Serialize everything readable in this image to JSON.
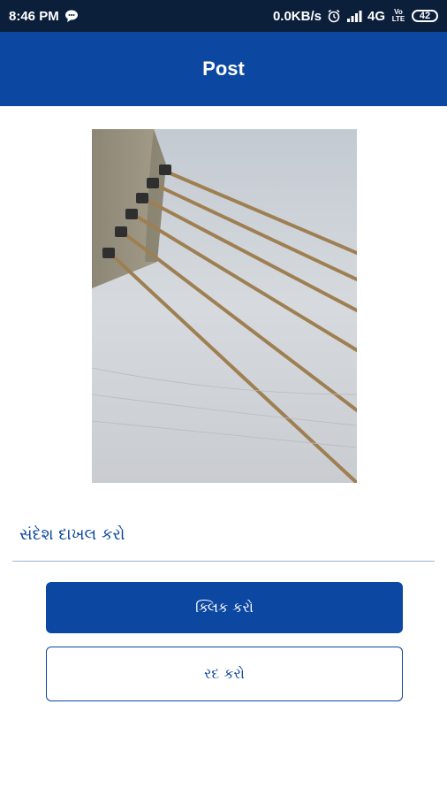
{
  "status_bar": {
    "time": "8:46 PM",
    "speed": "0.0KB/s",
    "network": "4G",
    "volte": "Vo LTE",
    "battery": "42",
    "notification_icon": "chat-bubble-icon",
    "alarm_icon": "alarm-icon",
    "signal_icon": "signal-icon"
  },
  "app_bar": {
    "title": "Post"
  },
  "image": {
    "subject": "cable-stayed-bridge-photo"
  },
  "message": {
    "placeholder": "સંદેશ દાખલ કરો"
  },
  "buttons": {
    "submit": "ક્લિક કરો",
    "cancel": "રદ કરો"
  },
  "colors": {
    "primary": "#0c47a1",
    "status_bar": "#0b1f3a",
    "background": "#ffffff"
  }
}
